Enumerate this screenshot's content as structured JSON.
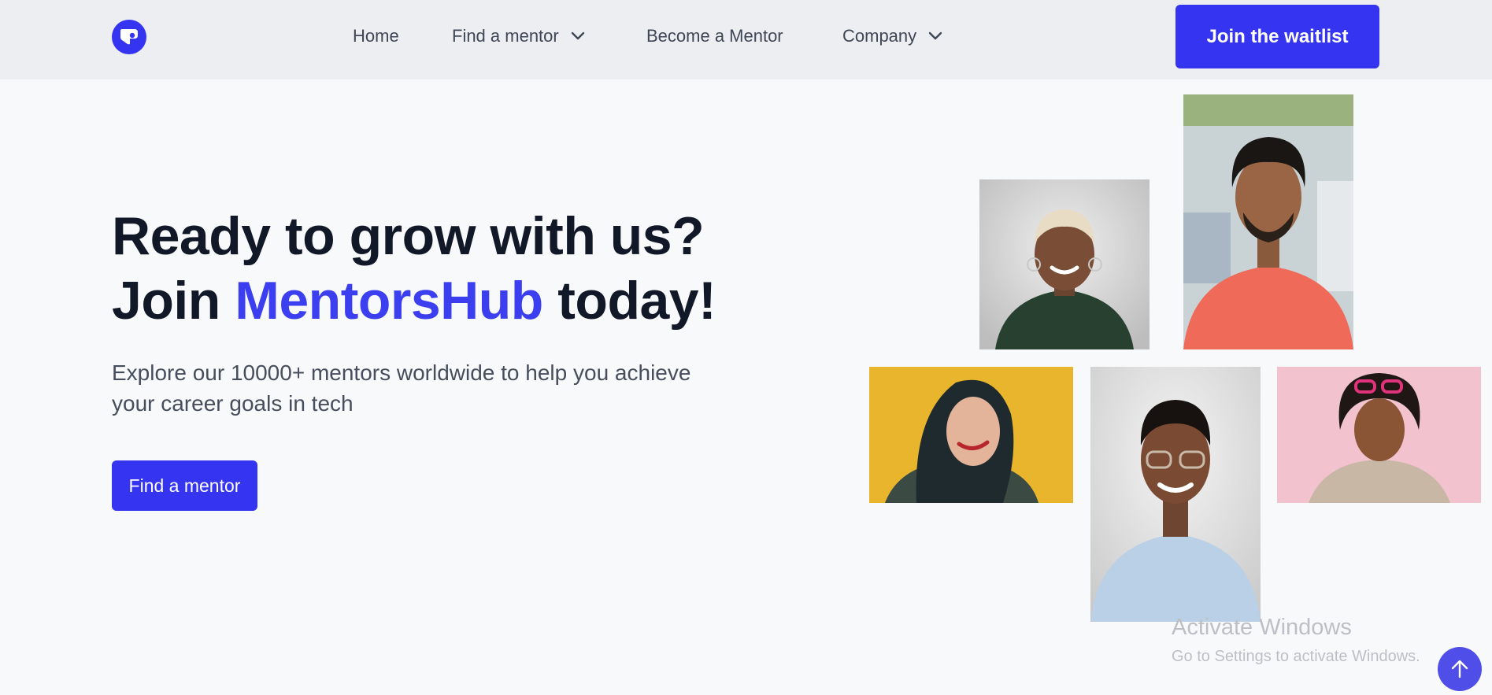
{
  "header": {
    "logo_icon": "mentorshub-logo-icon",
    "nav": {
      "home": "Home",
      "find_mentor": "Find a mentor",
      "become_mentor": "Become a Mentor",
      "company": "Company"
    },
    "waitlist_label": "Join the waitlist"
  },
  "hero": {
    "title_line1": "Ready to grow with us?",
    "title_join": "Join",
    "title_brand": "MentorsHub",
    "title_end": "today!",
    "subtitle": "Explore our 10000+ mentors worldwide to help you achieve your career goals in tech",
    "cta_label": "Find a mentor"
  },
  "colors": {
    "accent": "#3534f0",
    "brand_text": "#3b3ff0",
    "nav_bg": "#eceef2",
    "page_bg": "#f8f9fb"
  },
  "watermark": {
    "title": "Activate Windows",
    "subtitle": "Go to Settings to activate Windows."
  },
  "scroll_top_icon": "arrow-up-icon"
}
